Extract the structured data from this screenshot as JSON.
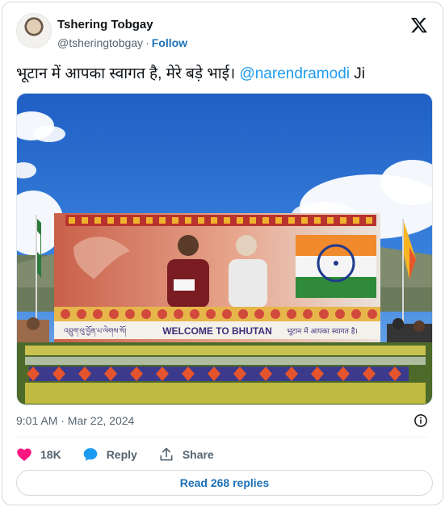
{
  "author": {
    "name": "Tshering Tobgay",
    "handle": "@tsheringtobgay",
    "separator": "·",
    "follow_label": "Follow"
  },
  "tweet": {
    "text": "भूटान में आपका स्वागत है, मेरे बड़े भाई। ",
    "mention": "@narendramodi",
    "suffix": " Ji"
  },
  "photo": {
    "banner_text": "WELCOME TO BHUTAN",
    "banner_left_script": "འབྲུག་ལུ་བྱོན་པ་ལེགས་སོ།",
    "banner_right_script": "भूटान में आपका स्वागत है।"
  },
  "meta": {
    "timestamp": "9:01 AM · Mar 22, 2024"
  },
  "actions": {
    "like_count": "18K",
    "reply_label": "Reply",
    "share_label": "Share"
  },
  "replies_button": "Read 268 replies",
  "icons": [
    "x-logo-icon",
    "info-icon",
    "heart-icon",
    "reply-bubble-icon",
    "share-icon"
  ],
  "colors": {
    "link": "#1d9bf0",
    "follow": "#1d70b8",
    "like": "#f91880",
    "reply": "#1d9bf0"
  }
}
